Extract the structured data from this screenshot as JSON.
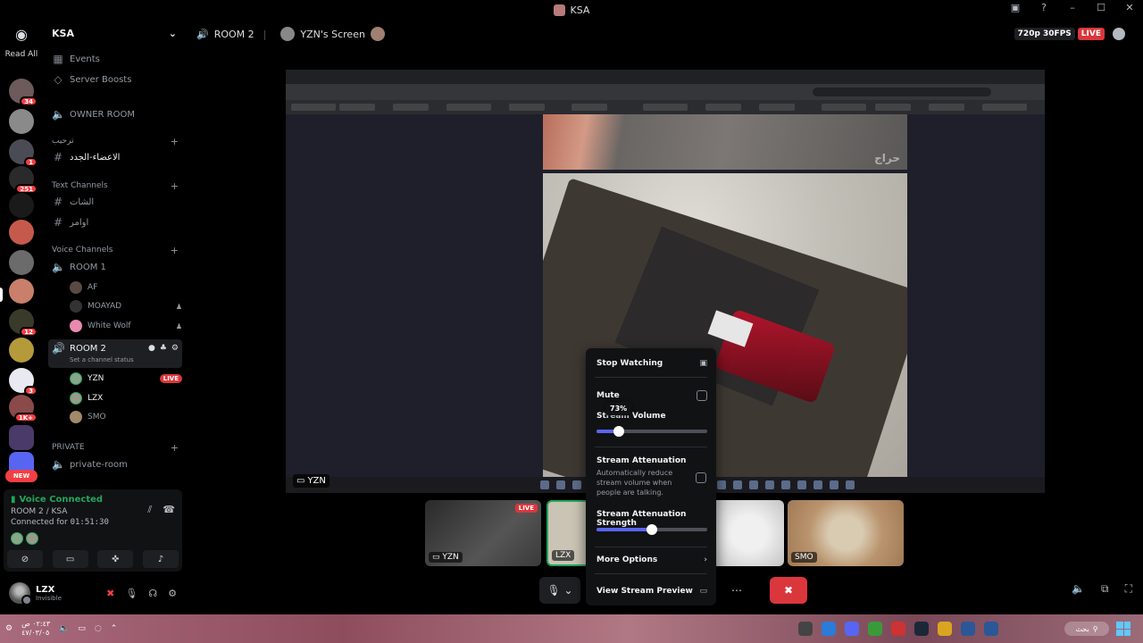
{
  "window": {
    "title": "KSA"
  },
  "rail": {
    "read_all": "Read All",
    "new_label": "NEW",
    "servers": [
      {
        "color": "#6d5a5a",
        "badge": "34"
      },
      {
        "color": "#8a8a8a",
        "badge": ""
      },
      {
        "color": "#4b4b55",
        "badge": "1"
      },
      {
        "color": "#2a2a2a",
        "badge": "251"
      },
      {
        "color": "#1a1a1a",
        "badge": ""
      },
      {
        "color": "#c55a4a",
        "badge": ""
      },
      {
        "color": "#6b6b6b",
        "badge": ""
      },
      {
        "color": "#c97f6a",
        "badge": ""
      },
      {
        "color": "#3a3a2a",
        "badge": "12"
      },
      {
        "color": "#b49a3a",
        "badge": ""
      },
      {
        "color": "#e9e9f2",
        "badge": "3"
      },
      {
        "color": "#8a4a4a",
        "badge": "1K+"
      },
      {
        "color": "#4a3a6a",
        "badge": ""
      },
      {
        "color": "#5865f2",
        "badge": ""
      }
    ]
  },
  "sidebar": {
    "guild_name": "KSA",
    "events": "Events",
    "boosts": "Server Boosts",
    "owner_room": "OWNER ROOM",
    "cat_welcome": "ترحيب",
    "ch_new_members": "الاعضاء-الجدد",
    "cat_text": "Text Channels",
    "ch_chat": "الشات",
    "ch_commands": "اوامر",
    "cat_voice": "Voice Channels",
    "room1": "ROOM 1",
    "room1_users": [
      "AF",
      "MOAYAD",
      "White Wolf"
    ],
    "room2": "ROOM 2",
    "room2_status": "Set a channel status",
    "room2_users": [
      "YZN",
      "LZX",
      "SMO"
    ],
    "live": "LIVE",
    "cat_private": "PRIVATE",
    "private_room": "private-room"
  },
  "voice": {
    "connected": "Voice Connected",
    "location": "ROOM 2 / KSA",
    "connected_for": "Connected for",
    "time": "01:51:30"
  },
  "me": {
    "name": "LZX",
    "status": "Invisible"
  },
  "stage": {
    "room": "ROOM 2",
    "screen_title": "YZN's Screen",
    "quality": "720p 30FPS",
    "live": "LIVE",
    "stream_user": "YZN",
    "watermark": "حراج"
  },
  "thumbs": [
    {
      "name": "YZN",
      "live": "LIVE"
    },
    {
      "name": "LZX"
    },
    {
      "name": ""
    },
    {
      "name": "SMO"
    }
  ],
  "menu": {
    "stop": "Stop Watching",
    "mute": "Mute",
    "volume_label": "Stream Volume",
    "volume_tip": "73%",
    "volume": 0.2,
    "attenuation": "Stream Attenuation",
    "attenuation_desc": "Automatically reduce stream volume when people are talking.",
    "attenuation_strength": "Stream Attenuation Strength",
    "strength": 0.5,
    "more": "More Options",
    "preview": "View Stream Preview"
  },
  "os": {
    "time": "٠٢:٤٣ ص",
    "date": "٤٧/٠٣/٠٥",
    "search": "بحث"
  }
}
